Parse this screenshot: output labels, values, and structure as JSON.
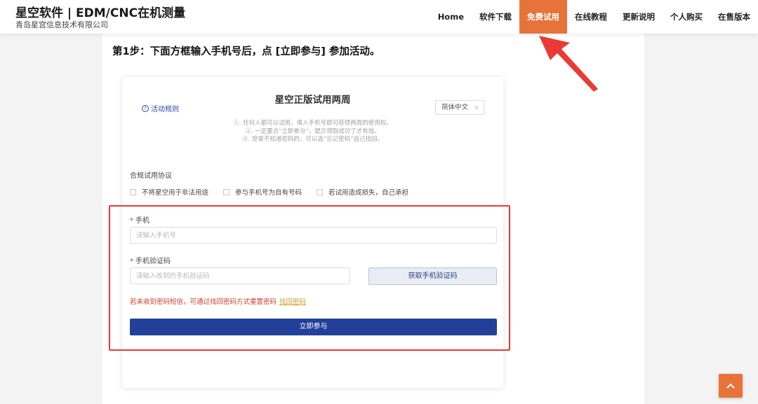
{
  "header": {
    "brand_title": "星空软件 | EDM/CNC在机测量",
    "brand_subtitle": "青岛星宫信息技术有限公司",
    "nav": [
      {
        "label": "Home",
        "active": false
      },
      {
        "label": "软件下载",
        "active": false
      },
      {
        "label": "免费试用",
        "active": true
      },
      {
        "label": "在线教程",
        "active": false
      },
      {
        "label": "更新说明",
        "active": false
      },
      {
        "label": "个人购买",
        "active": false
      },
      {
        "label": "在售版本",
        "active": false
      }
    ],
    "active_color": "#e8733a"
  },
  "main": {
    "step_text": "第1步：下面方框输入手机号后，点 [立即参与] 参加活动。"
  },
  "form": {
    "rules_link": "活动规则",
    "title": "星空正版试用两周",
    "language": "简体中文",
    "description": [
      "①. 任何人都可以试用，填入手机号即可获得两周的使用权。",
      "②. 一定要点“立即参与”，提示领取成功了才有效。",
      "③. 登录不知道密码的，可以选“忘记密码”自己找回。"
    ],
    "agreement_label": "合规试用协议",
    "agreements": [
      "不将星空用于非法用途",
      "参与手机号为自有号码",
      "若试用造成损失，自己承担"
    ],
    "required_mark": "*",
    "phone_label": "手机",
    "phone_placeholder": "请输入手机号",
    "code_label": "手机验证码",
    "code_placeholder": "请输入收到的手机验证码",
    "get_code_button": "获取手机验证码",
    "hint_text": "若未收到密码短信，可通过找回密码方式重置密码",
    "hint_link": "找回密码",
    "submit_button": "立即参与",
    "submit_color": "#22409a"
  },
  "annotation": {
    "highlight_color": "#e63b36"
  }
}
